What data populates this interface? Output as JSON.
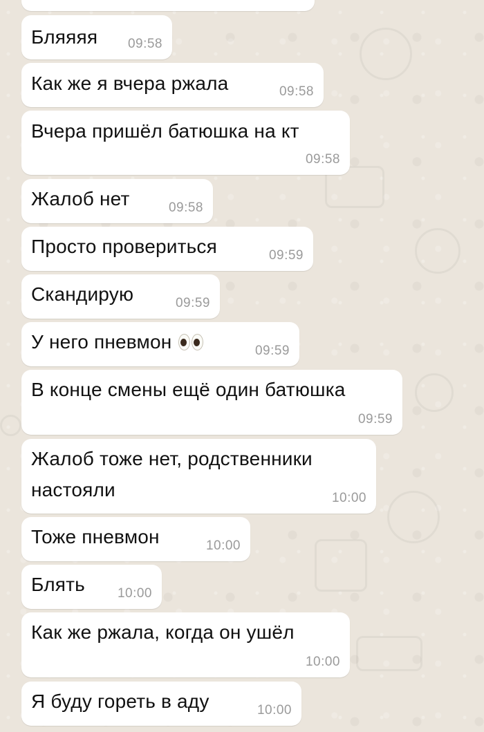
{
  "chat": {
    "messages": [
      {
        "text": "Бляяяя",
        "time": "09:58"
      },
      {
        "text": "Как же я вчера ржала",
        "time": "09:58"
      },
      {
        "text": "Вчера пришёл батюшка на кт",
        "time": "09:58"
      },
      {
        "text": "Жалоб нет",
        "time": "09:58"
      },
      {
        "text": "Просто провериться",
        "time": "09:59"
      },
      {
        "text": "Скандирую",
        "time": "09:59"
      },
      {
        "text": "У него пневмон",
        "time": "09:59",
        "emoji": "eyes"
      },
      {
        "text": "В конце смены ещё один батюшка",
        "time": "09:59"
      },
      {
        "text": "Жалоб тоже нет, родственники\nнастояли",
        "time": "10:00"
      },
      {
        "text": "Тоже пневмон",
        "time": "10:00"
      },
      {
        "text": "Блять",
        "time": "10:00"
      },
      {
        "text": "Как же ржала, когда он ушёл",
        "time": "10:00"
      },
      {
        "text": "Я буду гореть в аду",
        "time": "10:00"
      }
    ]
  }
}
